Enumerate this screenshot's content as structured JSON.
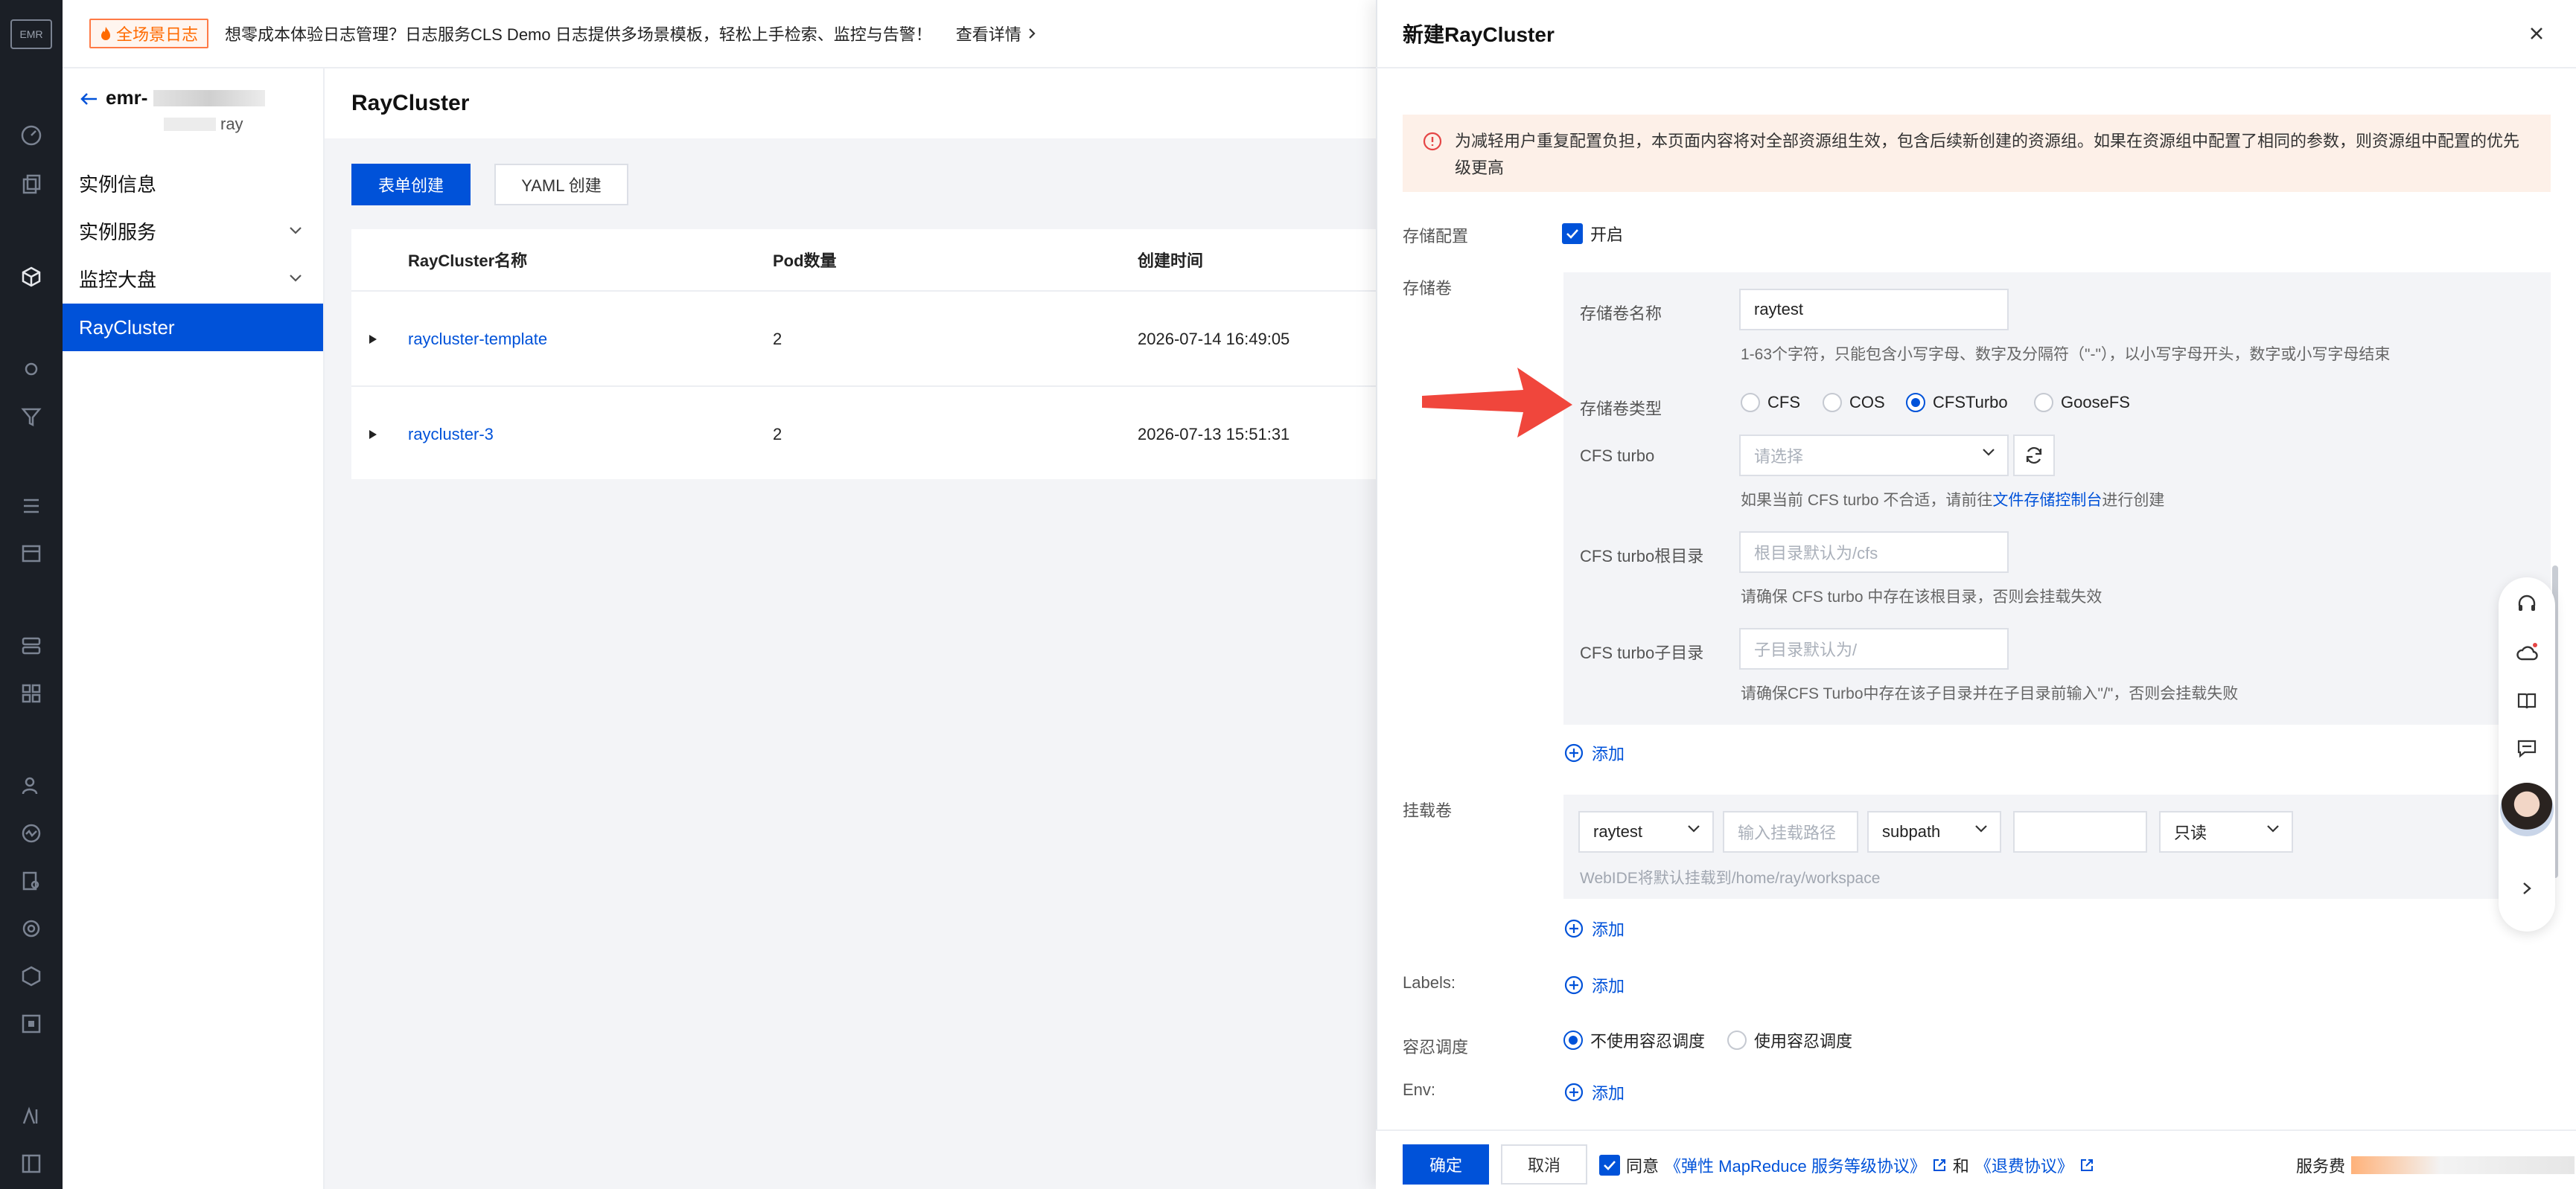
{
  "rail": {
    "logo": "EMR"
  },
  "banner": {
    "tag": "全场景日志",
    "text": "想零成本体验日志管理？日志服务CLS Demo 日志提供多场景模板，轻松上手检索、监控与告警！",
    "link": "查看详情"
  },
  "sidebar": {
    "instance_name": "emr-",
    "instance_sub": "ray",
    "items": [
      {
        "label": "实例信息"
      },
      {
        "label": "实例服务"
      },
      {
        "label": "监控大盘"
      },
      {
        "label": "RayCluster"
      }
    ]
  },
  "page": {
    "title": "RayCluster",
    "form_create": "表单创建",
    "yaml_create": "YAML 创建",
    "table": {
      "headers": [
        "RayCluster名称",
        "Pod数量",
        "创建时间"
      ],
      "rows": [
        {
          "name": "raycluster-template",
          "pods": "2",
          "created": "2026-07-14 16:49:05"
        },
        {
          "name": "raycluster-3",
          "pods": "2",
          "created": "2026-07-13 15:51:31"
        }
      ]
    }
  },
  "drawer": {
    "title": "新建RayCluster",
    "alert": "为减轻用户重复配置负担，本页面内容将对全部资源组生效，包含后续新创建的资源组。如果在资源组中配置了相同的参数，则资源组中配置的优先级更高",
    "storage_config_label": "存储配置",
    "storage_config_enabled": "开启",
    "volume_label": "存储卷",
    "volume_name_label": "存储卷名称",
    "volume_name_value": "raytest",
    "volume_name_help": "1-63个字符，只能包含小写字母、数字及分隔符（\"-\"），以小写字母开头，数字或小写字母结束",
    "volume_type_label": "存储卷类型",
    "volume_types": [
      "CFS",
      "COS",
      "CFSTurbo",
      "GooseFS"
    ],
    "volume_type_selected": "CFSTurbo",
    "cfs_turbo_label": "CFS turbo",
    "cfs_turbo_placeholder": "请选择",
    "cfs_turbo_help_prefix": "如果当前 CFS turbo 不合适，请前往",
    "cfs_turbo_help_link": "文件存储控制台",
    "cfs_turbo_help_suffix": "进行创建",
    "root_dir_label": "CFS turbo根目录",
    "root_dir_placeholder": "根目录默认为/cfs",
    "root_dir_help": "请确保 CFS turbo 中存在该根目录，否则会挂载失效",
    "sub_dir_label": "CFS turbo子目录",
    "sub_dir_placeholder": "子目录默认为/",
    "sub_dir_help": "请确保CFS Turbo中存在该子目录并在子目录前输入\"/\"，否则会挂载失败",
    "add_label": "添加",
    "mount_label": "挂载卷",
    "mount_volume": "raytest",
    "mount_path_placeholder": "输入挂载路径",
    "mount_subpath": "subpath",
    "mount_mode": "只读",
    "mount_help": "WebIDE将默认挂载到/home/ray/workspace",
    "labels_label": "Labels:",
    "toleration_label": "容忍调度",
    "toleration_options": [
      "不使用容忍调度",
      "使用容忍调度"
    ],
    "toleration_selected": "不使用容忍调度",
    "env_label": "Env:",
    "ok": "确定",
    "cancel": "取消",
    "agree_prefix": "同意",
    "agree_link1": "《弹性 MapReduce 服务等级协议》",
    "agree_and": "和",
    "agree_link2": "《退费协议》",
    "fee_label": "服务费"
  },
  "colors": {
    "primary": "#0052d9",
    "annotation_arrow": "#f0463c",
    "alert_bg": "#fdf0e8"
  }
}
